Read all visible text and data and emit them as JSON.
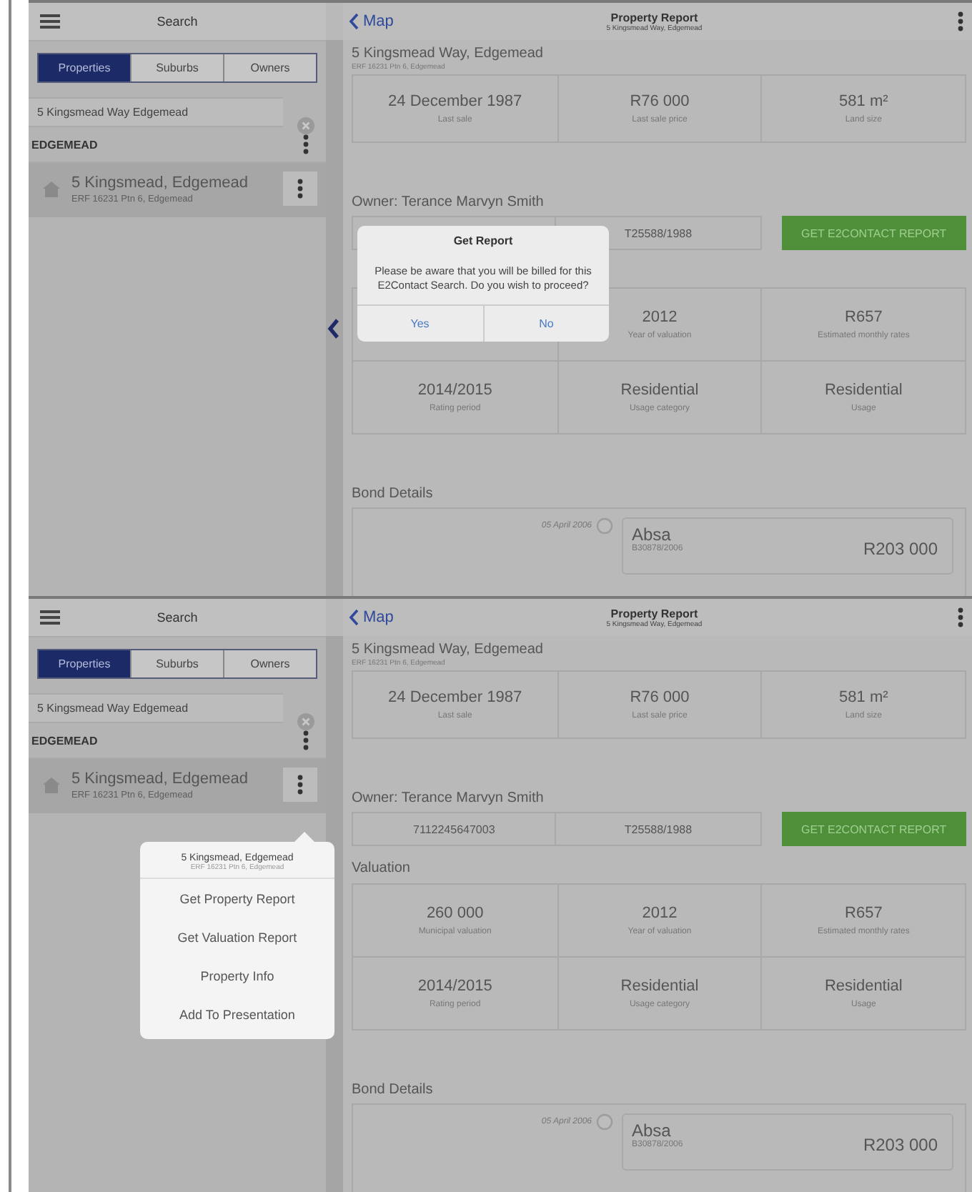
{
  "screens": [
    {
      "sidebar": {
        "title": "Search",
        "segments": [
          {
            "label": "Properties",
            "selected": true
          },
          {
            "label": "Suburbs",
            "selected": false
          },
          {
            "label": "Owners",
            "selected": false
          }
        ],
        "search": {
          "value": "5 Kingsmead Way Edgemead"
        },
        "groups": [
          {
            "title": "EDGEMEAD",
            "items": [
              {
                "title": "5 Kingsmead, Edgemead",
                "subtitle": "ERF 16231 Ptn 6, Edgemead",
                "selected": true
              }
            ]
          }
        ]
      },
      "collapse_handle": true,
      "header": {
        "back": "Map",
        "title": "Property Report",
        "subtitle": "5 Kingsmead Way, Edgemead"
      },
      "property": {
        "address": "5 Kingsmead Way, Edgemead",
        "erf": "ERF 16231 Ptn 6, Edgemead"
      },
      "summary": [
        {
          "value": "24 December 1987",
          "label": "Last sale"
        },
        {
          "value": "R76 000",
          "label": "Last sale price"
        },
        {
          "value": "581 m²",
          "label": "Land size"
        }
      ],
      "owner": {
        "title": "Owner: Terance Marvyn Smith",
        "deed": "T25588/1988",
        "button": "GET E2CONTACT REPORT"
      },
      "valuation": {
        "cells": [
          {},
          {
            "value": "2012",
            "label": "Year of valuation"
          },
          {
            "value": "R657",
            "label": "Estimated monthly rates"
          },
          {
            "value": "2014/2015",
            "label": "Rating period"
          },
          {
            "value": "Residential",
            "label": "Usage category"
          },
          {
            "value": "Residential",
            "label": "Usage"
          }
        ]
      },
      "bond": {
        "title": "Bond Details",
        "date": "05 April 2006",
        "bank": "Absa",
        "number": "B30878/2006",
        "amount": "R203 000"
      },
      "overlay": {
        "kind": "dialog",
        "title": "Get Report",
        "message": "Please be aware that you will be billed for this E2Contact Search. Do you wish to proceed?",
        "buttons": [
          "Yes",
          "No"
        ]
      }
    },
    {
      "sidebar": {
        "title": "Search",
        "segments": [
          {
            "label": "Properties",
            "selected": true
          },
          {
            "label": "Suburbs",
            "selected": false
          },
          {
            "label": "Owners",
            "selected": false
          }
        ],
        "search": {
          "value": "5 Kingsmead Way Edgemead"
        },
        "groups": [
          {
            "title": "EDGEMEAD",
            "items": [
              {
                "title": "5 Kingsmead, Edgemead",
                "subtitle": "ERF 16231 Ptn 6, Edgemead",
                "selected": true
              }
            ]
          }
        ]
      },
      "header": {
        "back": "Map",
        "title": "Property Report",
        "subtitle": "5 Kingsmead Way, Edgemead"
      },
      "property": {
        "address": "5 Kingsmead Way, Edgemead",
        "erf": "ERF 16231 Ptn 6, Edgemead"
      },
      "summary": [
        {
          "value": "24 December 1987",
          "label": "Last sale"
        },
        {
          "value": "R76 000",
          "label": "Last sale price"
        },
        {
          "value": "581 m²",
          "label": "Land size"
        }
      ],
      "owner": {
        "title": "Owner: Terance Marvyn Smith",
        "id_number": "7112245647003",
        "deed": "T25588/1988",
        "button": "GET E2CONTACT REPORT"
      },
      "valuation": {
        "title": "Valuation",
        "cells": [
          {
            "value": "260 000",
            "label": "Municipal valuation"
          },
          {
            "value": "2012",
            "label": "Year of valuation"
          },
          {
            "value": "R657",
            "label": "Estimated monthly rates"
          },
          {
            "value": "2014/2015",
            "label": "Rating period"
          },
          {
            "value": "Residential",
            "label": "Usage category"
          },
          {
            "value": "Residential",
            "label": "Usage"
          }
        ]
      },
      "bond": {
        "title": "Bond Details",
        "date": "05 April 2006",
        "bank": "Absa",
        "number": "B30878/2006",
        "amount": "R203 000"
      },
      "overlay": {
        "kind": "popover",
        "title": "5 Kingsmead, Edgemead",
        "subtitle": "ERF 16231 Ptn 6, Edgemead",
        "items": [
          "Get Property Report",
          "Get Valuation Report",
          "Property Info",
          "Add To Presentation"
        ]
      }
    }
  ]
}
